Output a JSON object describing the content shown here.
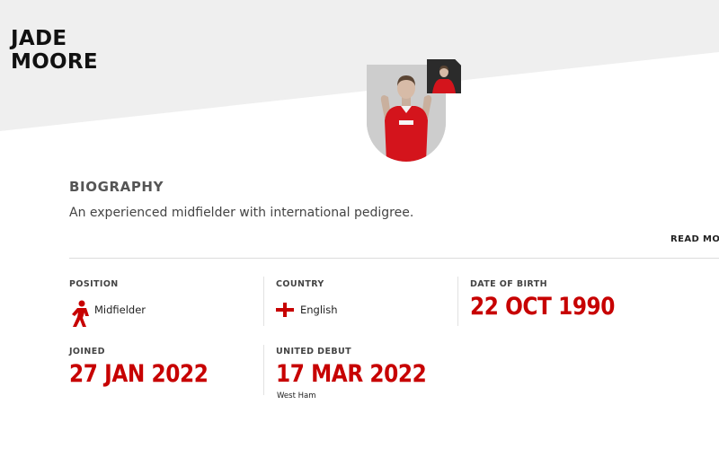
{
  "player": {
    "first_name": "JADE",
    "last_name": "MOORE"
  },
  "biography": {
    "heading": "BIOGRAPHY",
    "text": "An experienced midfielder with international pedigree.",
    "read_more": "READ MORE"
  },
  "stats": {
    "position": {
      "label": "POSITION",
      "value": "Midfielder",
      "icon": "midfielder-icon"
    },
    "country": {
      "label": "COUNTRY",
      "value": "English",
      "icon": "england-flag-icon"
    },
    "date_of_birth": {
      "label": "DATE OF BIRTH",
      "value": "22 OCT 1990"
    },
    "joined": {
      "label": "JOINED",
      "value": "27 JAN 2022"
    },
    "united_debut": {
      "label": "UNITED DEBUT",
      "value": "17 MAR 2022",
      "opponent": "West Ham"
    }
  },
  "colors": {
    "accent_red": "#c70101",
    "kit_red": "#d4141c",
    "background_grey": "#efefef"
  }
}
